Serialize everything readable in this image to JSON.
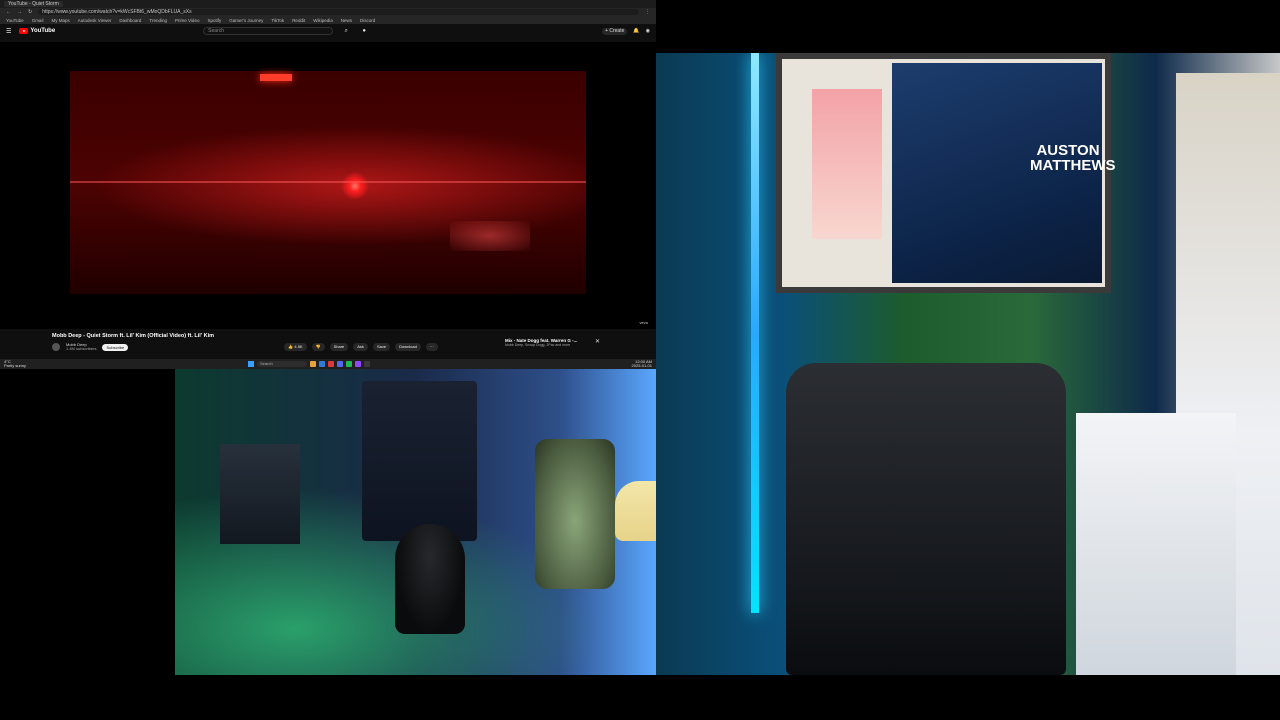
{
  "browser": {
    "tab_title": "YouTube - Quiet Storm",
    "url": "https://www.youtube.com/watch?v=kWcSFBt6_wMoQDbFLUA_sXs",
    "bookmarks": [
      "YouTube",
      "Gmail",
      "My Maps",
      "Autodesk Viewer",
      "Dashboard",
      "Trending",
      "Prime Video",
      "Spotify",
      "Gamer's Journey",
      "TikTok",
      "Reddit",
      "Wikipedia",
      "News",
      "Discord"
    ]
  },
  "youtube": {
    "logo_text": "YouTube",
    "search_placeholder": "Search",
    "create_label": "+ Create",
    "video_title": "Mobb Deep - Quiet Storm ft. Lil' Kim (Official Video) ft. Lil' Kim",
    "channel_name": "Mobb Deep",
    "channel_subs": "1.4M subscribers",
    "subscribe_label": "Subscribe",
    "like_count": "4.5K",
    "share_label": "Share",
    "ask_label": "Ask",
    "save_label": "Save",
    "download_label": "Download",
    "watermark": "vevo",
    "mix_title": "Mix - Nate Dogg feat. Warren G -...",
    "mix_subtitle": "Mobb Deep, Snoop Dogg, 2Pac and more"
  },
  "taskbar": {
    "weather_temp": "4°C",
    "weather_desc": "Partly sunny",
    "search_label": "Search",
    "time": "12:00 AM",
    "date": "2025-01-01"
  },
  "scene": {
    "poster_name": "AUSTON MATTHEWS"
  },
  "colors": {
    "youtube_red": "#ff0000",
    "video_glow": "#ff1e1e",
    "led_blue": "#29a8ff"
  }
}
